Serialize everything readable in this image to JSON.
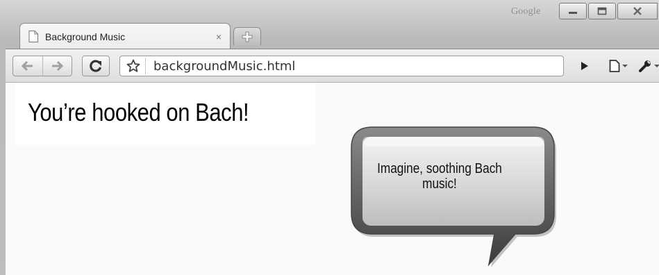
{
  "window": {
    "title_brand": "Google",
    "controls": {
      "minimize_icon": "minimize-icon",
      "maximize_icon": "maximize-icon",
      "close_icon": "close-icon"
    }
  },
  "tabs": [
    {
      "title": "Background Music",
      "close_glyph": "×",
      "active": true
    }
  ],
  "toolbar": {
    "address": "backgroundMusic.html",
    "icons": [
      "back-arrow-icon",
      "forward-arrow-icon",
      "reload-icon",
      "star-icon",
      "play-icon",
      "page-menu-icon",
      "wrench-icon"
    ]
  },
  "page": {
    "heading": "You’re hooked on Bach!",
    "bubble_text": "Imagine, soothing Bach music!"
  },
  "colors": {
    "chrome_frame": "#c4c4c4",
    "page_background": "#fafafa",
    "bubble_fill": "#d9d9d9"
  }
}
